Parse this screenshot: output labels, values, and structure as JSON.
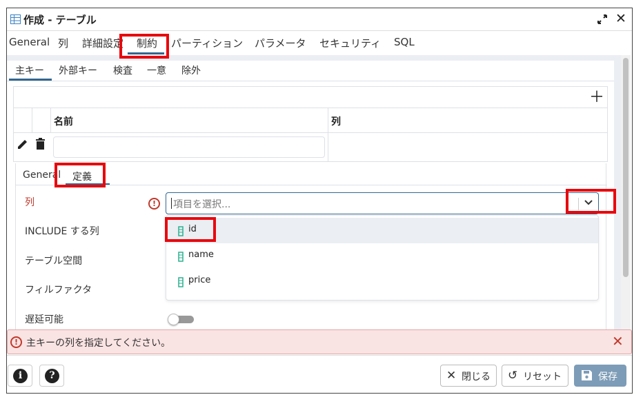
{
  "window": {
    "title": "作成 - テーブル"
  },
  "main_tabs": [
    "General",
    "列",
    "詳細設定",
    "制約",
    "パーティション",
    "パラメータ",
    "セキュリティ",
    "SQL"
  ],
  "constraint_tabs": [
    "主キー",
    "外部キー",
    "検査",
    "一意",
    "除外"
  ],
  "grid": {
    "columns": [
      "名前",
      "列"
    ]
  },
  "definition_tabs": [
    "General",
    "定義"
  ],
  "form": {
    "column_label": "列",
    "include_label": "INCLUDE する列",
    "tablespace_label": "テーブル空間",
    "fillfactor_label": "フィルファクタ",
    "deferrable_label": "遅延可能",
    "select_placeholder": "項目を選択...",
    "deferrable_on": false
  },
  "dropdown": {
    "options": [
      "id",
      "name",
      "price"
    ],
    "highlighted": "id"
  },
  "error": {
    "message": "主キーの列を指定してください。"
  },
  "footer": {
    "close_label": "閉じる",
    "reset_label": "リセット",
    "save_label": "保存"
  },
  "colors": {
    "accent": "#326690",
    "error": "#c0392b",
    "highlight_box": "#e8080d",
    "save_button": "#7d9cb7",
    "column_icon": "#2bb08f"
  },
  "icons": [
    "table-icon",
    "expand-icon",
    "close-icon",
    "add-icon",
    "edit-icon",
    "trash-icon",
    "warning-icon",
    "chevron-down-icon",
    "column-icon",
    "info-icon",
    "help-icon",
    "save-icon",
    "reset-icon"
  ]
}
